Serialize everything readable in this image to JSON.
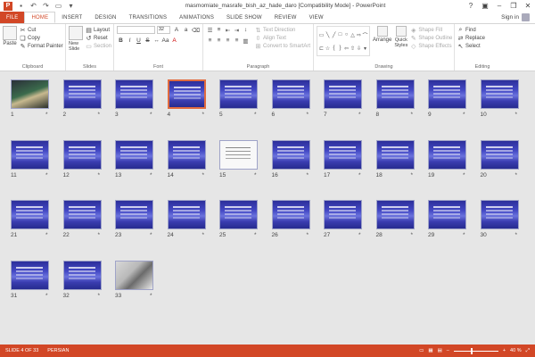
{
  "app": {
    "title": "masmomiate_masrafe_bish_az_hade_daro [Compatibility Mode] - PowerPoint",
    "logo": "P"
  },
  "tabs": [
    "FILE",
    "HOME",
    "INSERT",
    "DESIGN",
    "TRANSITIONS",
    "ANIMATIONS",
    "SLIDE SHOW",
    "REVIEW",
    "VIEW"
  ],
  "active_tab": "HOME",
  "signin": "Sign in",
  "ribbon": {
    "clipboard": {
      "paste": "Paste",
      "cut": "Cut",
      "copy": "Copy",
      "format_painter": "Format Painter",
      "label": "Clipboard"
    },
    "slides": {
      "new_slide": "New Slide",
      "layout": "Layout",
      "reset": "Reset",
      "section": "Section",
      "label": "Slides"
    },
    "font": {
      "size": "32",
      "bold": "B",
      "italic": "I",
      "underline": "U",
      "strike": "S",
      "label": "Font"
    },
    "paragraph": {
      "text_direction": "Text Direction",
      "align_text": "Align Text",
      "convert_smartart": "Convert to SmartArt",
      "label": "Paragraph"
    },
    "drawing": {
      "arrange": "Arrange",
      "quick_styles": "Quick Styles",
      "shape_fill": "Shape Fill",
      "shape_outline": "Shape Outline",
      "shape_effects": "Shape Effects",
      "label": "Drawing"
    },
    "editing": {
      "find": "Find",
      "replace": "Replace",
      "select": "Select",
      "label": "Editing"
    }
  },
  "slides": [
    {
      "n": "1",
      "style": "photo"
    },
    {
      "n": "2",
      "style": "blue"
    },
    {
      "n": "3",
      "style": "blue"
    },
    {
      "n": "4",
      "style": "blue"
    },
    {
      "n": "5",
      "style": "blue"
    },
    {
      "n": "6",
      "style": "blue"
    },
    {
      "n": "7",
      "style": "blue"
    },
    {
      "n": "8",
      "style": "blue"
    },
    {
      "n": "9",
      "style": "blue"
    },
    {
      "n": "10",
      "style": "blue"
    },
    {
      "n": "11",
      "style": "blue"
    },
    {
      "n": "12",
      "style": "blue"
    },
    {
      "n": "13",
      "style": "blue"
    },
    {
      "n": "14",
      "style": "blue"
    },
    {
      "n": "15",
      "style": "doc"
    },
    {
      "n": "16",
      "style": "blue"
    },
    {
      "n": "17",
      "style": "blue"
    },
    {
      "n": "18",
      "style": "blue"
    },
    {
      "n": "19",
      "style": "blue"
    },
    {
      "n": "20",
      "style": "blue"
    },
    {
      "n": "21",
      "style": "blue"
    },
    {
      "n": "22",
      "style": "blue"
    },
    {
      "n": "23",
      "style": "blue"
    },
    {
      "n": "24",
      "style": "blue"
    },
    {
      "n": "25",
      "style": "blue"
    },
    {
      "n": "26",
      "style": "blue"
    },
    {
      "n": "27",
      "style": "blue"
    },
    {
      "n": "28",
      "style": "blue"
    },
    {
      "n": "29",
      "style": "blue"
    },
    {
      "n": "30",
      "style": "blue"
    },
    {
      "n": "31",
      "style": "blue"
    },
    {
      "n": "32",
      "style": "blue"
    },
    {
      "n": "33",
      "style": "laptop"
    }
  ],
  "selected_slide": "4",
  "star": "*",
  "status": {
    "slide": "SLIDE 4 OF 33",
    "language": "PERSIAN",
    "zoom": "40 %",
    "zoom_level": 0.4
  },
  "colors": {
    "accent": "#d24726",
    "selection": "#e06b3f"
  }
}
